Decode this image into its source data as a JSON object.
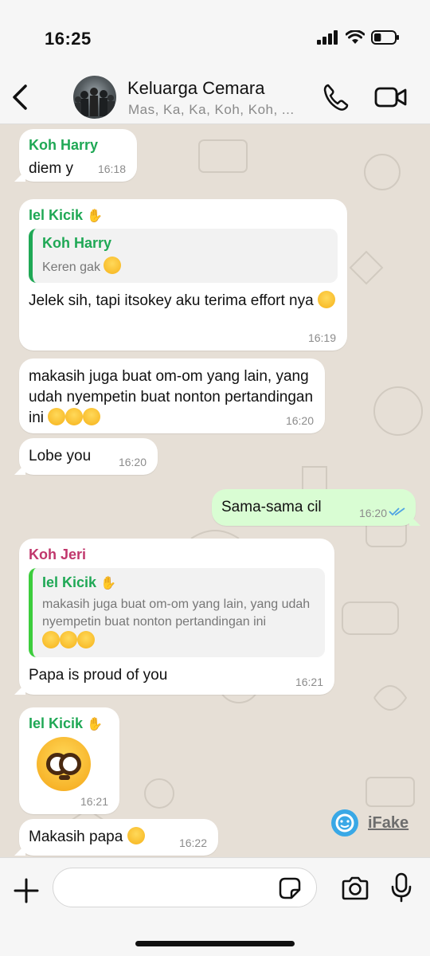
{
  "status": {
    "time": "16:25",
    "battery_level": 0.35
  },
  "header": {
    "back_icon": "chevron-left-icon",
    "title": "Keluarga Cemara",
    "subtitle": "Mas, Ka, Ka, Koh, Koh, ...",
    "call_icon": "phone-icon",
    "video_icon": "video-camera-icon"
  },
  "messages": [
    {
      "sender": "Koh Harry",
      "text": "diem y",
      "time": "16:18"
    },
    {
      "sender": "Iel Kicik",
      "quote_sender": "Koh Harry",
      "quote_text": "Keren gak",
      "text": "Jelek sih, tapi itsokey aku terima effort nya",
      "time": "16:19"
    },
    {
      "text": "makasih juga buat om-om yang lain, yang udah nyempetin buat nonton pertandingan ini",
      "time": "16:20"
    },
    {
      "text": "Lobe you",
      "time": "16:20"
    },
    {
      "text": "Sama-sama cil",
      "time": "16:20",
      "outgoing": true
    },
    {
      "sender": "Koh Jeri",
      "quote_sender": "Iel Kicik",
      "quote_text": "makasih juga buat om-om yang lain, yang udah nyempetin buat nonton pertandingan ini",
      "text": "Papa is proud of you",
      "time": "16:21"
    },
    {
      "sender": "Iel Kicik",
      "emoji": "flushed-face-emoji",
      "time": "16:21"
    },
    {
      "text": "Makasih papa",
      "time": "16:22"
    }
  ],
  "watermark": {
    "text": "iFake"
  },
  "composer": {
    "placeholder": "",
    "plus_icon": "plus-icon",
    "sticker_icon": "sticker-icon",
    "camera_icon": "camera-icon",
    "mic_icon": "microphone-icon"
  },
  "colors": {
    "incoming_bubble": "#ffffff",
    "outgoing_bubble": "#d9fdd3",
    "sender_green": "#1fa855",
    "sender_pink": "#c0376c",
    "tick_blue": "#4fa3e3"
  }
}
